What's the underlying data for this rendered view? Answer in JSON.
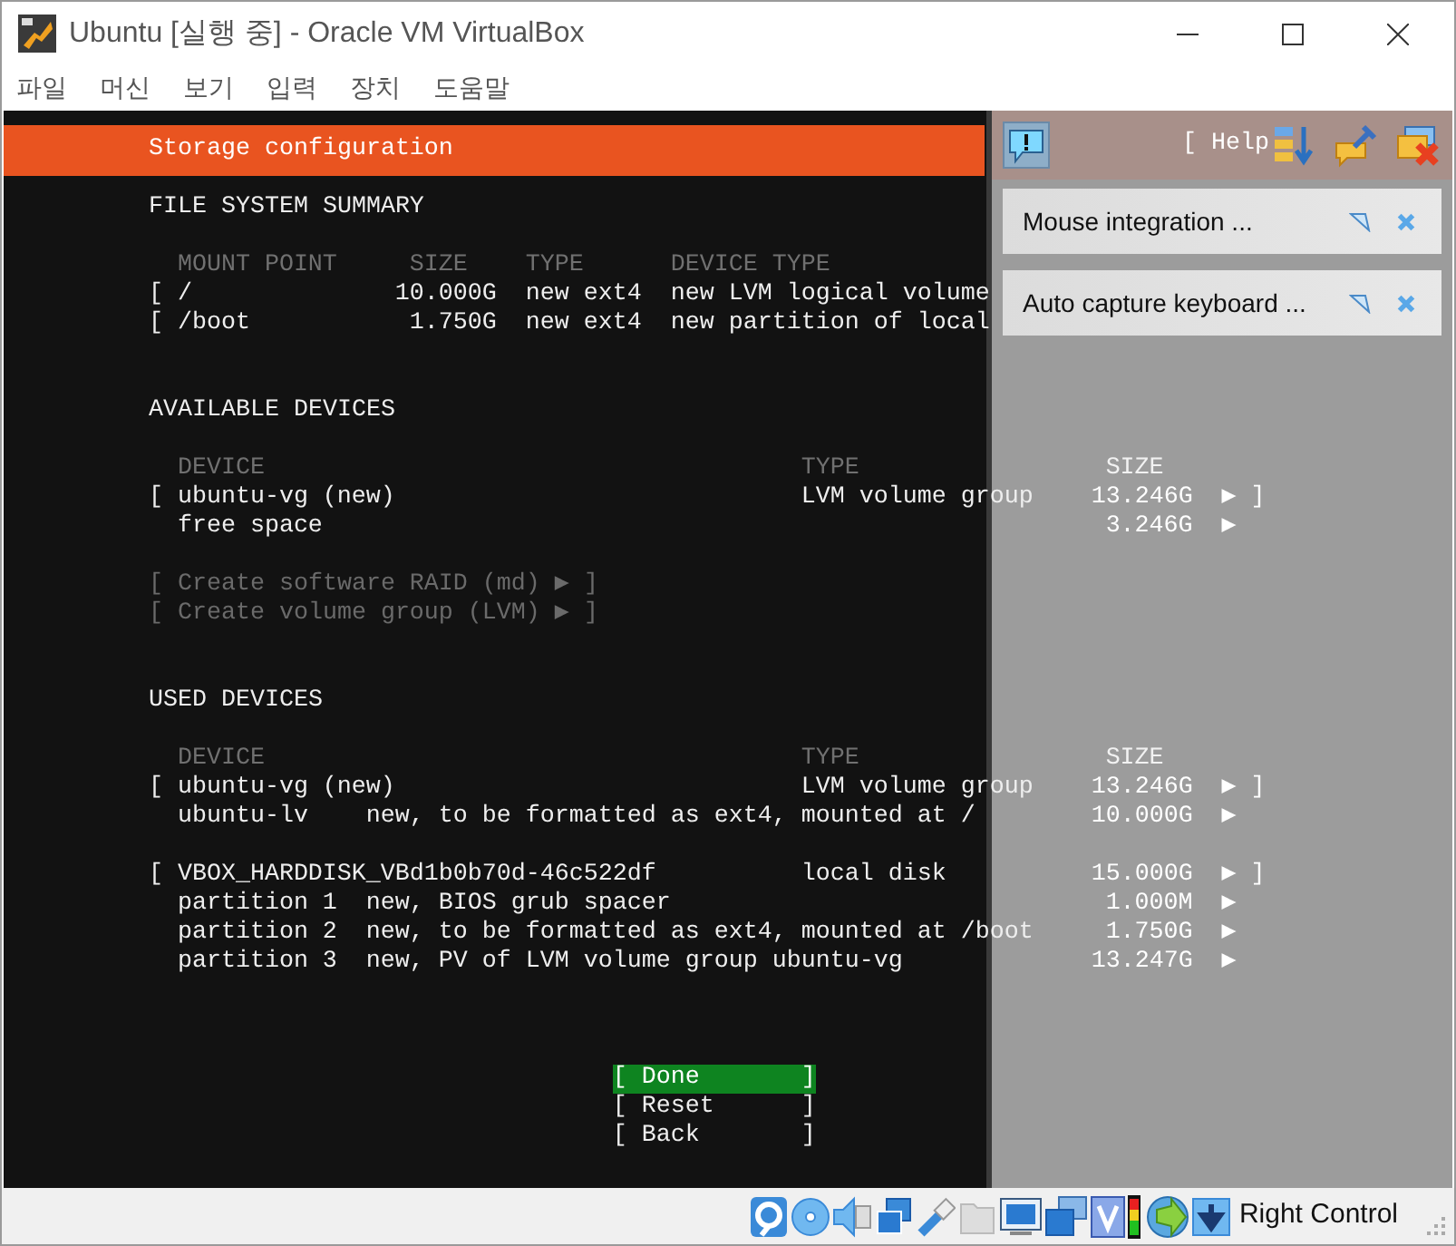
{
  "window": {
    "title": "Ubuntu [실행 중] - Oracle VM VirtualBox"
  },
  "menu": [
    {
      "label": "파일"
    },
    {
      "label": "머신"
    },
    {
      "label": "보기"
    },
    {
      "label": "입력"
    },
    {
      "label": "장치"
    },
    {
      "label": "도움말"
    }
  ],
  "installer": {
    "title": "Storage configuration",
    "file_system_summary": {
      "heading": "FILE SYSTEM SUMMARY",
      "columns": [
        "MOUNT POINT",
        "SIZE",
        "TYPE",
        "DEVICE TYPE"
      ],
      "rows": [
        {
          "bracket": "[",
          "mount_point": "/",
          "size": "10.000G",
          "type": "new ext4",
          "device_type": "new LVM logical volume"
        },
        {
          "bracket": "[",
          "mount_point": "/boot",
          "size": "1.750G",
          "type": "new ext4",
          "device_type": "new partition of local"
        }
      ]
    },
    "available_devices": {
      "heading": "AVAILABLE DEVICES",
      "columns": [
        "DEVICE",
        "TYPE",
        "SIZE"
      ],
      "groups": [
        {
          "rows": [
            {
              "kind": "device",
              "bracket": "[",
              "device": "ubuntu-vg (new)",
              "type": "LVM volume group",
              "size": "13.246G",
              "arrow": "▶",
              "close": "]"
            },
            {
              "kind": "sub",
              "name": "free space",
              "size": "3.246G",
              "arrow": "▶"
            }
          ]
        }
      ],
      "actions": [
        {
          "label": "[ Create software RAID (md) ▶ ]",
          "disabled": true
        },
        {
          "label": "[ Create volume group (LVM) ▶ ]",
          "disabled": true
        }
      ]
    },
    "used_devices": {
      "heading": "USED DEVICES",
      "columns": [
        "DEVICE",
        "TYPE",
        "SIZE"
      ],
      "groups": [
        {
          "rows": [
            {
              "kind": "device",
              "bracket": "[",
              "device": "ubuntu-vg (new)",
              "type": "LVM volume group",
              "size": "13.246G",
              "arrow": "▶",
              "close": "]"
            },
            {
              "kind": "sub",
              "name": "ubuntu-lv",
              "description": "new, to be formatted as ext4, mounted at /",
              "size": "10.000G",
              "arrow": "▶"
            }
          ]
        },
        {
          "rows": [
            {
              "kind": "device",
              "bracket": "[",
              "device": "VBOX_HARDDISK_VBd1b0b70d-46c522df",
              "type": "local disk",
              "size": "15.000G",
              "arrow": "▶",
              "close": "]"
            },
            {
              "kind": "sub",
              "name": "partition 1",
              "description": "new, BIOS grub spacer",
              "size": "1.000M",
              "arrow": "▶"
            },
            {
              "kind": "sub",
              "name": "partition 2",
              "description": "new, to be formatted as ext4, mounted at /boot",
              "size": "1.750G",
              "arrow": "▶"
            },
            {
              "kind": "sub",
              "name": "partition 3",
              "description": "new, PV of LVM volume group ubuntu-vg",
              "size": "13.247G",
              "arrow": "▶"
            }
          ]
        }
      ]
    },
    "buttons": [
      {
        "label": "[ Done       ]",
        "selected": true
      },
      {
        "label": "[ Reset      ]",
        "selected": false
      },
      {
        "label": "[ Back       ]",
        "selected": false
      }
    ]
  },
  "notification_panel": {
    "help": "[ Help",
    "messages": [
      {
        "text": "Mouse integration ..."
      },
      {
        "text": "Auto capture keyboard ..."
      }
    ]
  },
  "status_bar": {
    "host_key": "Right Control"
  }
}
